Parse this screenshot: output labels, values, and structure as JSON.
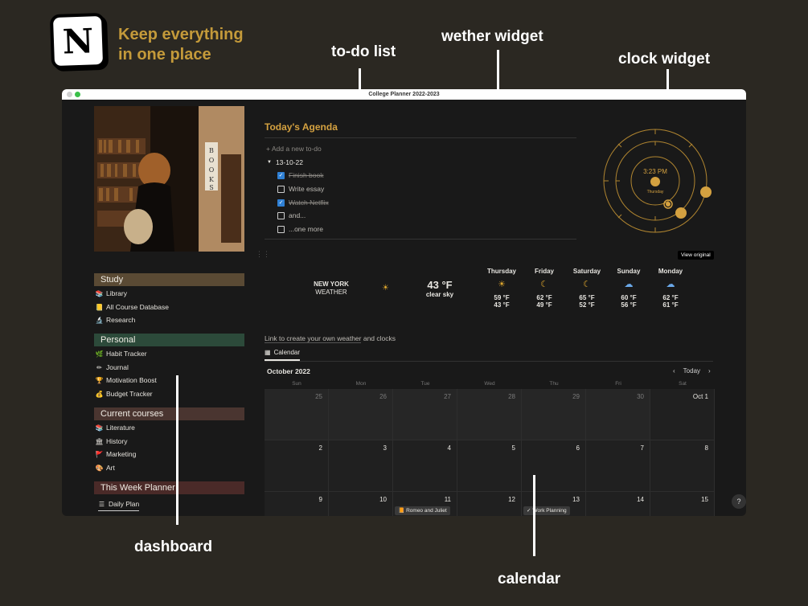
{
  "promo": {
    "logo_letter": "N",
    "tagline_1": "Keep everything",
    "tagline_2": "in one place",
    "callouts": {
      "todo": "to-do list",
      "weather": "wether widget",
      "clock": "clock widget",
      "dashboard": "dashboard",
      "calendar": "calendar"
    }
  },
  "window": {
    "title": "College Planner 2022-2023"
  },
  "sidebar": {
    "photo_sign": "BOOKS",
    "sections": [
      {
        "title": "Study",
        "color": "#5a4a34",
        "items": [
          {
            "icon": "books-icon",
            "glyph": "📚",
            "label": "Library"
          },
          {
            "icon": "notebook-icon",
            "glyph": "📒",
            "label": "All Course Database"
          },
          {
            "icon": "microscope-icon",
            "glyph": "🔬",
            "label": "Research"
          }
        ]
      },
      {
        "title": "Personal",
        "color": "#2c4a3a",
        "items": [
          {
            "icon": "leaf-icon",
            "glyph": "🌿",
            "label": "Habit Tracker"
          },
          {
            "icon": "pencil-icon",
            "glyph": "✏",
            "label": "Journal"
          },
          {
            "icon": "trophy-icon",
            "glyph": "🏆",
            "label": "Motivation Boost"
          },
          {
            "icon": "money-bag-icon",
            "glyph": "💰",
            "label": "Budget Tracker"
          }
        ]
      },
      {
        "title": "Current courses",
        "color": "#4a3530",
        "items": [
          {
            "icon": "books-icon",
            "glyph": "📚",
            "label": "Literature"
          },
          {
            "icon": "building-icon",
            "glyph": "🏛",
            "label": "History"
          },
          {
            "icon": "flag-icon",
            "glyph": "🚩",
            "label": "Marketing"
          },
          {
            "icon": "palette-icon",
            "glyph": "🎨",
            "label": "Art"
          }
        ]
      },
      {
        "title": "This Week Planner",
        "color": "#4a2a28",
        "items": [
          {
            "icon": "list-icon",
            "glyph": "☰",
            "label": "Daily Plan"
          }
        ]
      }
    ]
  },
  "agenda": {
    "title": "Today's Agenda",
    "add_label": "+ Add a new to-do",
    "date_group": "13-10-22",
    "todos": [
      {
        "label": "Finish book",
        "done": true
      },
      {
        "label": "Write essay",
        "done": false
      },
      {
        "label": "Watch Netflix",
        "done": true
      },
      {
        "label": "and...",
        "done": false
      },
      {
        "label": "...one more",
        "done": false
      }
    ]
  },
  "clock": {
    "time": "3:23 PM",
    "day": "Thursday",
    "view_original": "View original"
  },
  "weather": {
    "city": "NEW YORK",
    "subtitle": "WEATHER",
    "current_temp": "43 °F",
    "current_cond": "clear sky",
    "current_icon": "sun-icon",
    "forecast": [
      {
        "day": "Thursday",
        "icon": "sun-icon",
        "glyph": "☀",
        "high": "59 °F",
        "low": "43 °F",
        "color": "#e0a82e"
      },
      {
        "day": "Friday",
        "icon": "moon-icon",
        "glyph": "☾",
        "high": "62 °F",
        "low": "49 °F",
        "color": "#e0a82e"
      },
      {
        "day": "Saturday",
        "icon": "moon-icon",
        "glyph": "☾",
        "high": "65 °F",
        "low": "52 °F",
        "color": "#e0a82e"
      },
      {
        "day": "Sunday",
        "icon": "rain-cloud-icon",
        "glyph": "☁",
        "high": "60 °F",
        "low": "56 °F",
        "color": "#6aa8e8"
      },
      {
        "day": "Monday",
        "icon": "rain-cloud-icon",
        "glyph": "☁",
        "high": "62 °F",
        "low": "61 °F",
        "color": "#6aa8e8"
      }
    ]
  },
  "link": {
    "text_link": "Link to create your own weather",
    "text_rest": " and clocks"
  },
  "calendar": {
    "tab_label": "Calendar",
    "month": "October 2022",
    "today_label": "Today",
    "weekdays": [
      "Sun",
      "Mon",
      "Tue",
      "Wed",
      "Thu",
      "Fri",
      "Sat"
    ],
    "weeks": [
      [
        {
          "d": "25",
          "grey": true
        },
        {
          "d": "26",
          "grey": true
        },
        {
          "d": "27",
          "grey": true
        },
        {
          "d": "28",
          "grey": true
        },
        {
          "d": "29",
          "grey": true
        },
        {
          "d": "30",
          "grey": true
        },
        {
          "d": "Oct 1",
          "grey": false
        }
      ],
      [
        {
          "d": "2"
        },
        {
          "d": "3"
        },
        {
          "d": "4"
        },
        {
          "d": "5"
        },
        {
          "d": "6"
        },
        {
          "d": "7"
        },
        {
          "d": "8"
        }
      ],
      [
        {
          "d": "9"
        },
        {
          "d": "10"
        },
        {
          "d": "11"
        },
        {
          "d": "12"
        },
        {
          "d": "13"
        },
        {
          "d": "14"
        },
        {
          "d": "15"
        }
      ]
    ],
    "events": [
      {
        "label": "Romeo and Juliet",
        "icon": "book-icon",
        "glyph": "📙",
        "week": 2,
        "col": 2
      },
      {
        "label": "Work Planning",
        "icon": "check-icon",
        "glyph": "✓",
        "week": 2,
        "col": 4
      }
    ]
  },
  "help_label": "?"
}
